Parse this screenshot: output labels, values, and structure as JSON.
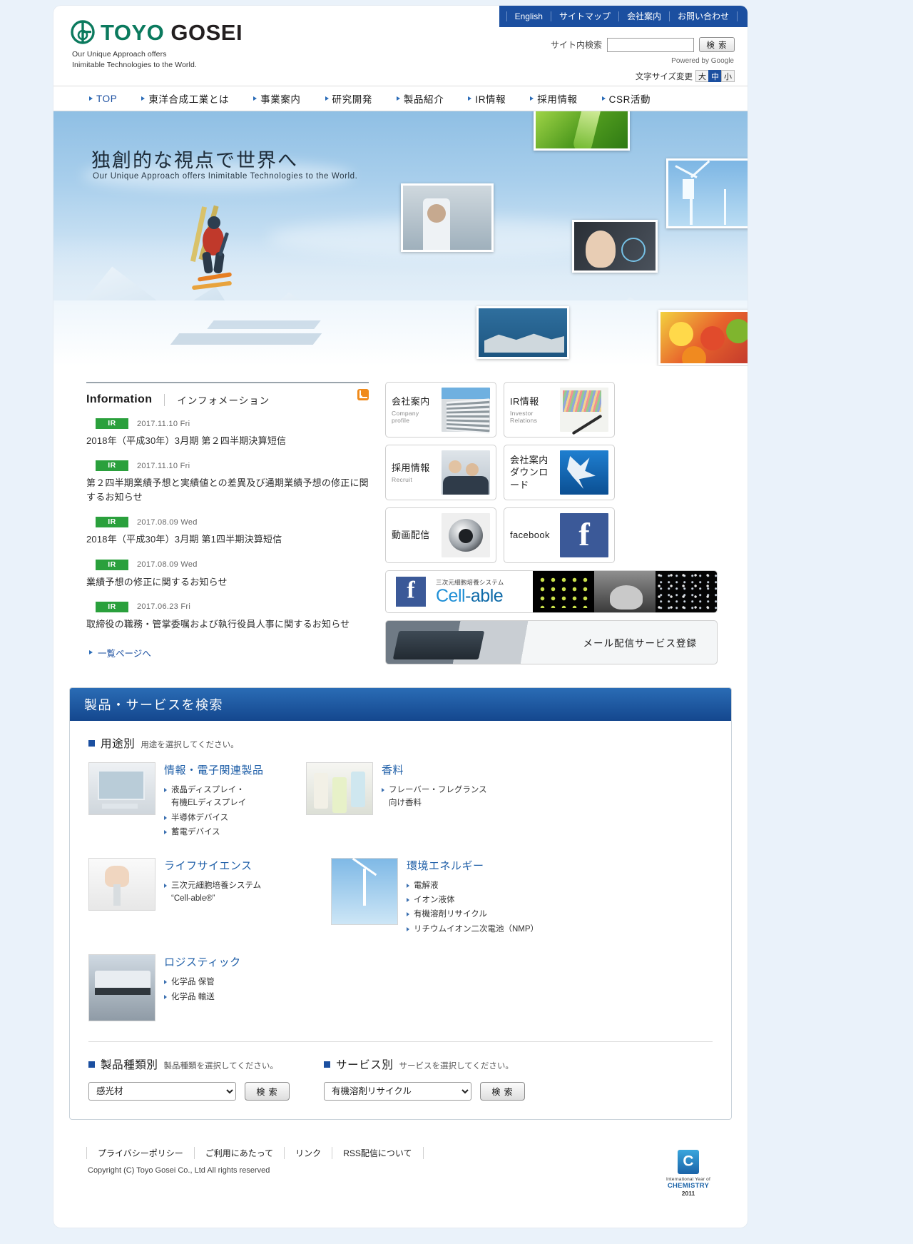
{
  "header": {
    "logo_text_1": "TOYO",
    "logo_text_2": "GOSEI",
    "tagline_line1": "Our Unique Approach offers",
    "tagline_line2": "Inimitable Technologies to the World.",
    "util_links": [
      "English",
      "サイトマップ",
      "会社案内",
      "お問い合わせ"
    ],
    "search_label": "サイト内検索",
    "search_value": "",
    "search_placeholder": "",
    "search_button": "検 索",
    "powered_by": "Powered by Google",
    "fontsize_label": "文字サイズ変更",
    "fontsize_options": [
      "大",
      "中",
      "小"
    ],
    "fontsize_selected": "中"
  },
  "gnav": [
    {
      "label": "TOP",
      "active": true
    },
    {
      "label": "東洋合成工業とは",
      "active": false
    },
    {
      "label": "事業案内",
      "active": false
    },
    {
      "label": "研究開発",
      "active": false
    },
    {
      "label": "製品紹介",
      "active": false
    },
    {
      "label": "IR情報",
      "active": false
    },
    {
      "label": "採用情報",
      "active": false
    },
    {
      "label": "CSR活動",
      "active": false
    }
  ],
  "hero": {
    "title": "独創的な視点で世界へ",
    "subtitle": "Our Unique Approach offers Inimitable Technologies to the World."
  },
  "information": {
    "heading_en": "Information",
    "heading_jp": "インフォメーション",
    "rss_icon": "rss-icon",
    "items": [
      {
        "category": "IR",
        "date": "2017.11.10 Fri",
        "title": "2018年（平成30年）3月期 第２四半期決算短信"
      },
      {
        "category": "IR",
        "date": "2017.11.10 Fri",
        "title": "第２四半期業績予想と実績値との差異及び通期業績予想の修正に関するお知らせ"
      },
      {
        "category": "IR",
        "date": "2017.08.09 Wed",
        "title": "2018年（平成30年）3月期 第1四半期決算短信"
      },
      {
        "category": "IR",
        "date": "2017.08.09 Wed",
        "title": "業績予想の修正に関するお知らせ"
      },
      {
        "category": "IR",
        "date": "2017.06.23 Fri",
        "title": "取締役の職務・管掌委嘱および執行役員人事に関するお知らせ"
      }
    ],
    "more_label": "一覧ページへ"
  },
  "tiles": [
    {
      "jp": "会社案内",
      "en": "Company profile",
      "img": "building-photo"
    },
    {
      "jp": "IR情報",
      "en": "Investor Relations",
      "img": "chart-pen-photo"
    },
    {
      "jp": "採用情報",
      "en": "Recruit",
      "img": "people-photo"
    },
    {
      "jp": "会社案内\nダウンロード",
      "en": "",
      "img": "water-splash-photo"
    },
    {
      "jp": "動画配信",
      "en": "",
      "img": "camera-lens-photo"
    },
    {
      "jp": "facebook",
      "en": "",
      "img": "facebook-logo"
    }
  ],
  "cell_banner": {
    "sup": "三次元細胞培養システム",
    "logo_a": "Cell",
    "logo_b": "-able",
    "fb_icon": "facebook-icon"
  },
  "mail_banner": {
    "label": "メール配信サービス登録"
  },
  "product_search": {
    "title": "製品・サービスを検索",
    "use_heading_big": "用途別",
    "use_heading_small": "用途を選択してください。",
    "uses": [
      {
        "thumb": "monitor-photo",
        "title": "情報・電子関連製品",
        "links": [
          "液晶ディスプレイ・\n有機ELディスプレイ",
          "半導体デバイス",
          "蓄電デバイス"
        ]
      },
      {
        "thumb": "bottles-photo",
        "title": "香料",
        "links": [
          "フレーバー・フレグランス\n向け香料"
        ]
      },
      {
        "thumb": "hand-photo",
        "title": "ライフサイエンス",
        "links": [
          "三次元細胞培養システム\n“Cell-able®”"
        ]
      },
      {
        "thumb": "windmill-photo",
        "title": "環境エネルギー",
        "links": [
          "電解液",
          "イオン液体",
          "有機溶剤リサイクル",
          "リチウムイオン二次電池（NMP）"
        ]
      },
      {
        "thumb": "truck-photo",
        "title": "ロジスティック",
        "links": [
          "化学品 保管",
          "化学品 輸送"
        ]
      }
    ],
    "type_heading_big": "製品種類別",
    "type_heading_small": "製品種類を選択してください。",
    "type_selected": "感光材",
    "type_button": "検 索",
    "service_heading_big": "サービス別",
    "service_heading_small": "サービスを選択してください。",
    "service_selected": "有機溶剤リサイクル",
    "service_button": "検 索"
  },
  "footer": {
    "links": [
      "プライバシーポリシー",
      "ご利用にあたって",
      "リンク",
      "RSS配信について"
    ],
    "copyright": "Copyright (C) Toyo Gosei Co., Ltd All rights reserved",
    "iyc_line1": "International Year of",
    "iyc_line2": "CHEMISTRY",
    "iyc_line3": "2011"
  }
}
